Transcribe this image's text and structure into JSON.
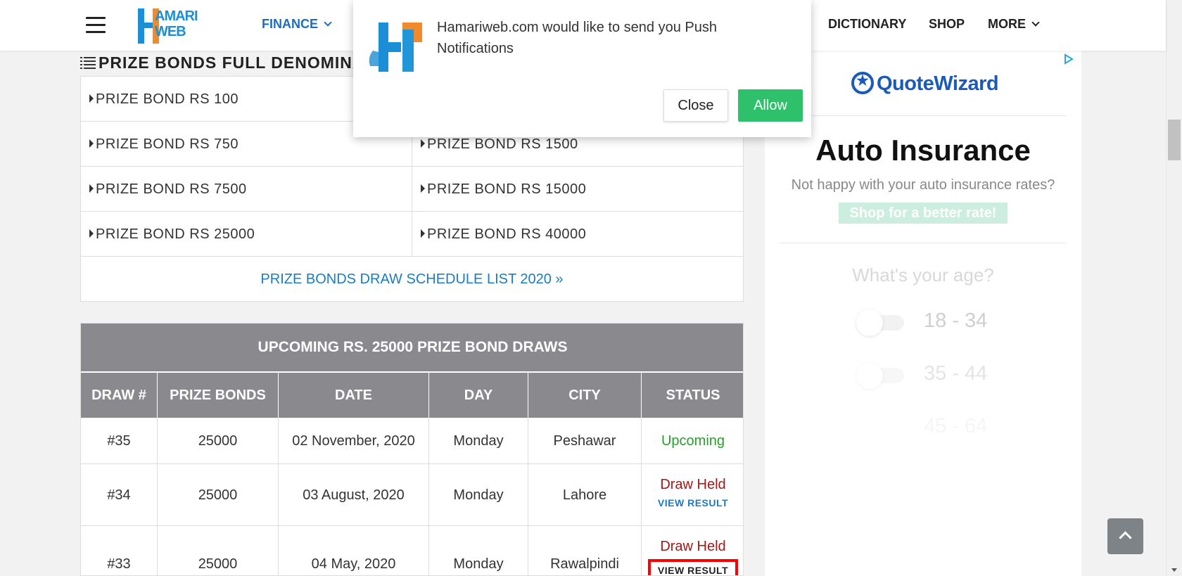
{
  "header": {
    "logo_line1": "AMARI",
    "logo_line2": "WEB",
    "nav": {
      "finance": "FINANCE",
      "dictionary": "DICTIONARY",
      "shop": "SHOP",
      "more": "MORE"
    }
  },
  "popup": {
    "message": "Hamariweb.com would like to send you Push Notifications",
    "close_label": "Close",
    "allow_label": "Allow"
  },
  "denominations": {
    "title": "PRIZE BONDS FULL DENOMINA",
    "rows": [
      {
        "left": "PRIZE BOND RS 100",
        "right": ""
      },
      {
        "left": "PRIZE BOND RS 750",
        "right": "PRIZE BOND RS 1500"
      },
      {
        "left": "PRIZE BOND RS 7500",
        "right": "PRIZE BOND RS 15000"
      },
      {
        "left": "PRIZE BOND RS 25000",
        "right": "PRIZE BOND RS 40000"
      }
    ],
    "schedule_link": "PRIZE BONDS DRAW SCHEDULE LIST 2020 »"
  },
  "upcoming": {
    "title": "UPCOMING RS. 25000 PRIZE BOND DRAWS",
    "headers": [
      "DRAW #",
      "PRIZE BONDS",
      "DATE",
      "DAY",
      "CITY",
      "STATUS"
    ],
    "rows": [
      {
        "draw": "#35",
        "bonds": "25000",
        "date": "02 November, 2020",
        "day": "Monday",
        "city": "Peshawar",
        "status": "Upcoming",
        "link": ""
      },
      {
        "draw": "#34",
        "bonds": "25000",
        "date": "03 August, 2020",
        "day": "Monday",
        "city": "Lahore",
        "status": "Draw Held",
        "link": "VIEW RESULT"
      },
      {
        "draw": "#33",
        "bonds": "25000",
        "date": "04 May, 2020",
        "day": "Monday",
        "city": "Rawalpindi",
        "status": "Draw Held",
        "link": "VIEW RESULT"
      }
    ]
  },
  "ad": {
    "brand": "QuoteWizard",
    "headline": "Auto Insurance",
    "subline": "Not happy with your auto insurance rates?",
    "cta": "Shop for a better rate!",
    "question": "What's your age?",
    "ages": [
      "18 - 34",
      "35 - 44",
      "45 - 64"
    ]
  },
  "colors": {
    "accent_blue": "#1a7cc4",
    "allow_green": "#2ec06a",
    "table_header_gray": "#8a8a8e",
    "status_upcoming": "#2a9d2a",
    "status_held": "#a01818"
  }
}
